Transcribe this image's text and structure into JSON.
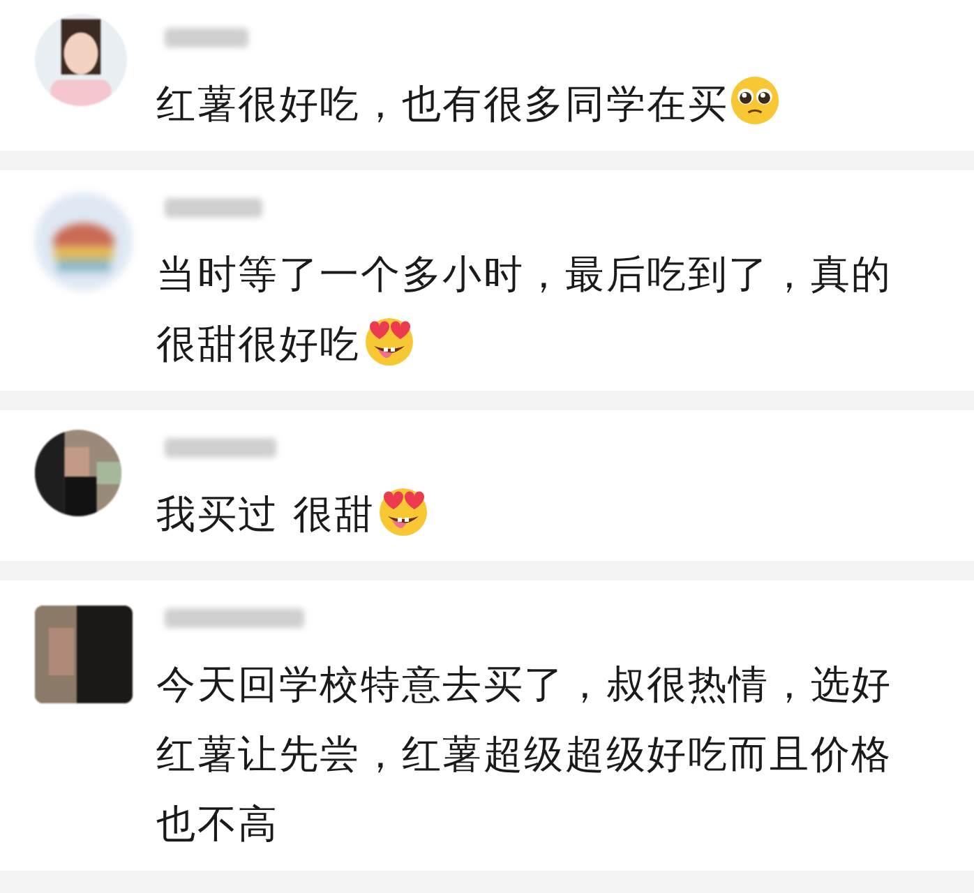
{
  "comments": [
    {
      "lines": [
        "红薯很好吃，也有很多同学在买"
      ],
      "emoji": {
        "kind": "pleading"
      }
    },
    {
      "lines": [
        "当时等了一个多小时，最后吃到了，真的",
        "很甜很好吃"
      ],
      "emoji": {
        "kind": "heart-eyes"
      }
    },
    {
      "lines": [
        "我买过 很甜"
      ],
      "emoji": {
        "kind": "heart-eyes"
      }
    },
    {
      "lines": [
        "今天回学校特意去买了，叔很热情，选好",
        "红薯让先尝，红薯超级超级好吃而且价格",
        "也不高"
      ]
    }
  ]
}
